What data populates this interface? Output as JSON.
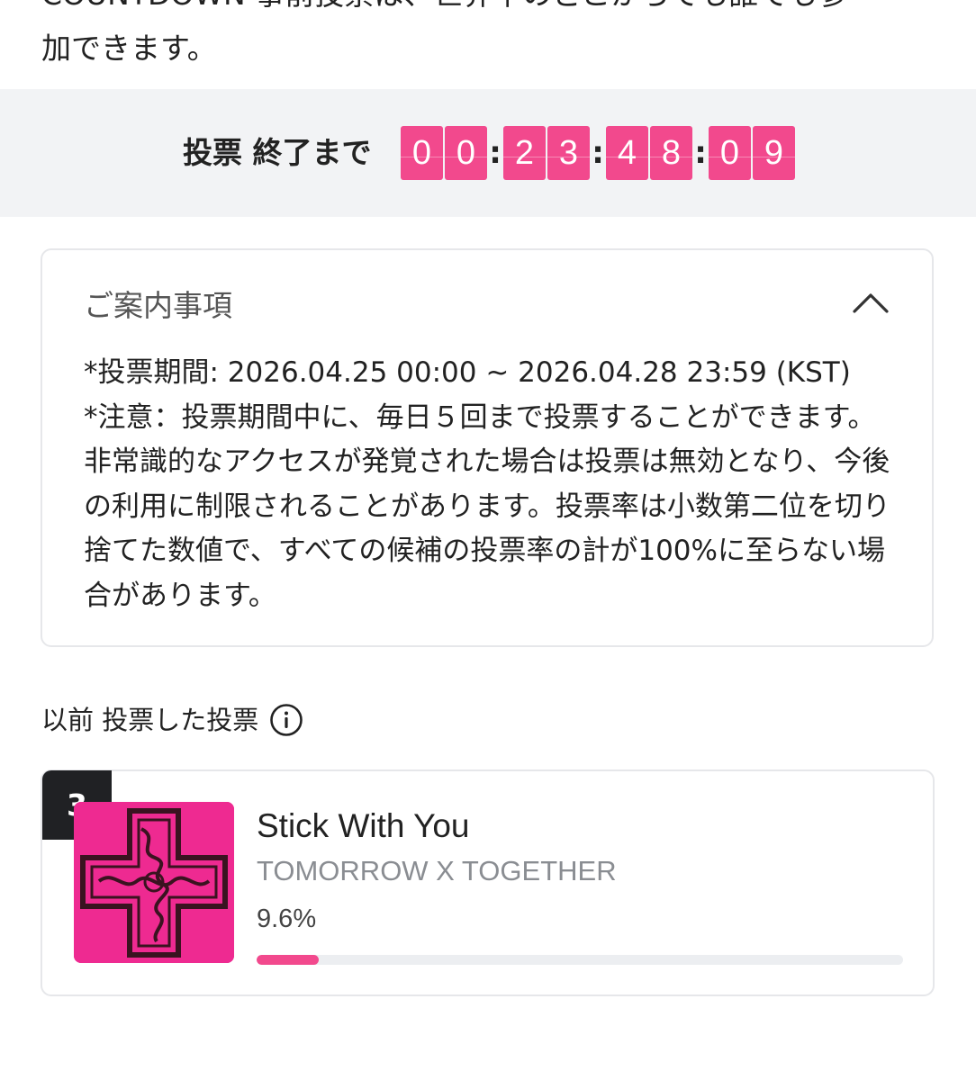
{
  "intro": {
    "line1_partial": "COUNTDOWN 事前投票は、世界中のどこからでも誰でも参",
    "line2": "加できます。"
  },
  "timer": {
    "label": "投票 終了まで",
    "digits": [
      "0",
      "0",
      "2",
      "3",
      "4",
      "8",
      "0",
      "9"
    ],
    "separator": ":"
  },
  "notice": {
    "title": "ご案内事項",
    "toggle_icon": "chevron-up-icon",
    "period": "*投票期間: 2026.04.25 00:00 ~ 2026.04.28 23:59 (KST)",
    "caution": "*注意：投票期間中に、毎日５回まで投票することができます。非常識的なアクセスが発覚された場合は投票は無効となり、今後の利用に制限されることがあります。投票率は小数第二位を切り捨てた数値で、すべての候補の投票率の計が100%に至らない場合があります。"
  },
  "previous": {
    "heading": "以前 投票した投票",
    "info_icon": "info-circle-icon"
  },
  "card": {
    "rank": "3",
    "title": "Stick With You",
    "artist": "TOMORROW X TOGETHER",
    "percent_label": "9.6%",
    "percent_value": 9.6,
    "accent": "#f2498d",
    "album_color": "#ee2a91"
  }
}
